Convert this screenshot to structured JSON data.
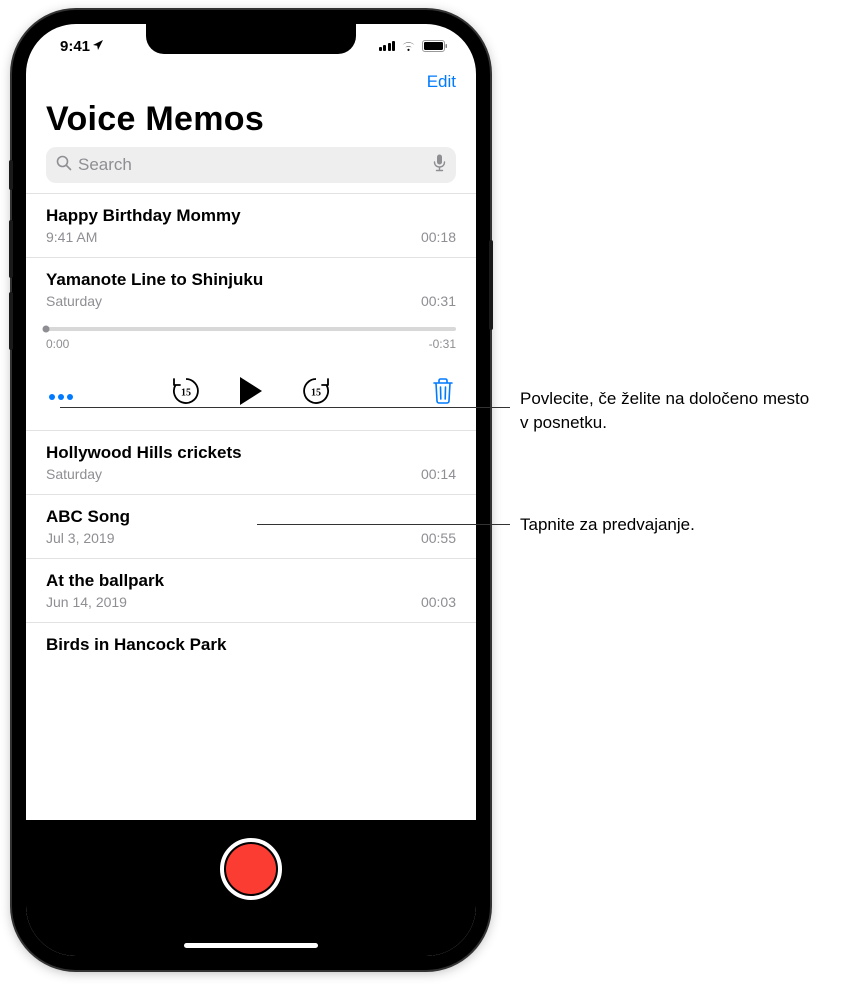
{
  "status_bar": {
    "time": "9:41"
  },
  "nav": {
    "edit_label": "Edit"
  },
  "header": {
    "title": "Voice Memos"
  },
  "search": {
    "placeholder": "Search"
  },
  "recordings": [
    {
      "title": "Happy Birthday Mommy",
      "date": "9:41 AM",
      "duration": "00:18"
    },
    {
      "title": "Yamanote Line to Shinjuku",
      "date": "Saturday",
      "duration": "00:31"
    },
    {
      "title": "Hollywood Hills crickets",
      "date": "Saturday",
      "duration": "00:14"
    },
    {
      "title": "ABC Song",
      "date": "Jul 3, 2019",
      "duration": "00:55"
    },
    {
      "title": "At the ballpark",
      "date": "Jun 14, 2019",
      "duration": "00:03"
    },
    {
      "title": "Birds in Hancock Park",
      "date": "",
      "duration": ""
    }
  ],
  "player": {
    "elapsed": "0:00",
    "remaining": "-0:31"
  },
  "callouts": {
    "scrub": "Povlecite, če želite na določeno mesto v posnetku.",
    "play": "Tapnite za predvajanje."
  },
  "colors": {
    "accent": "#007aff",
    "record": "#fb3c33"
  }
}
